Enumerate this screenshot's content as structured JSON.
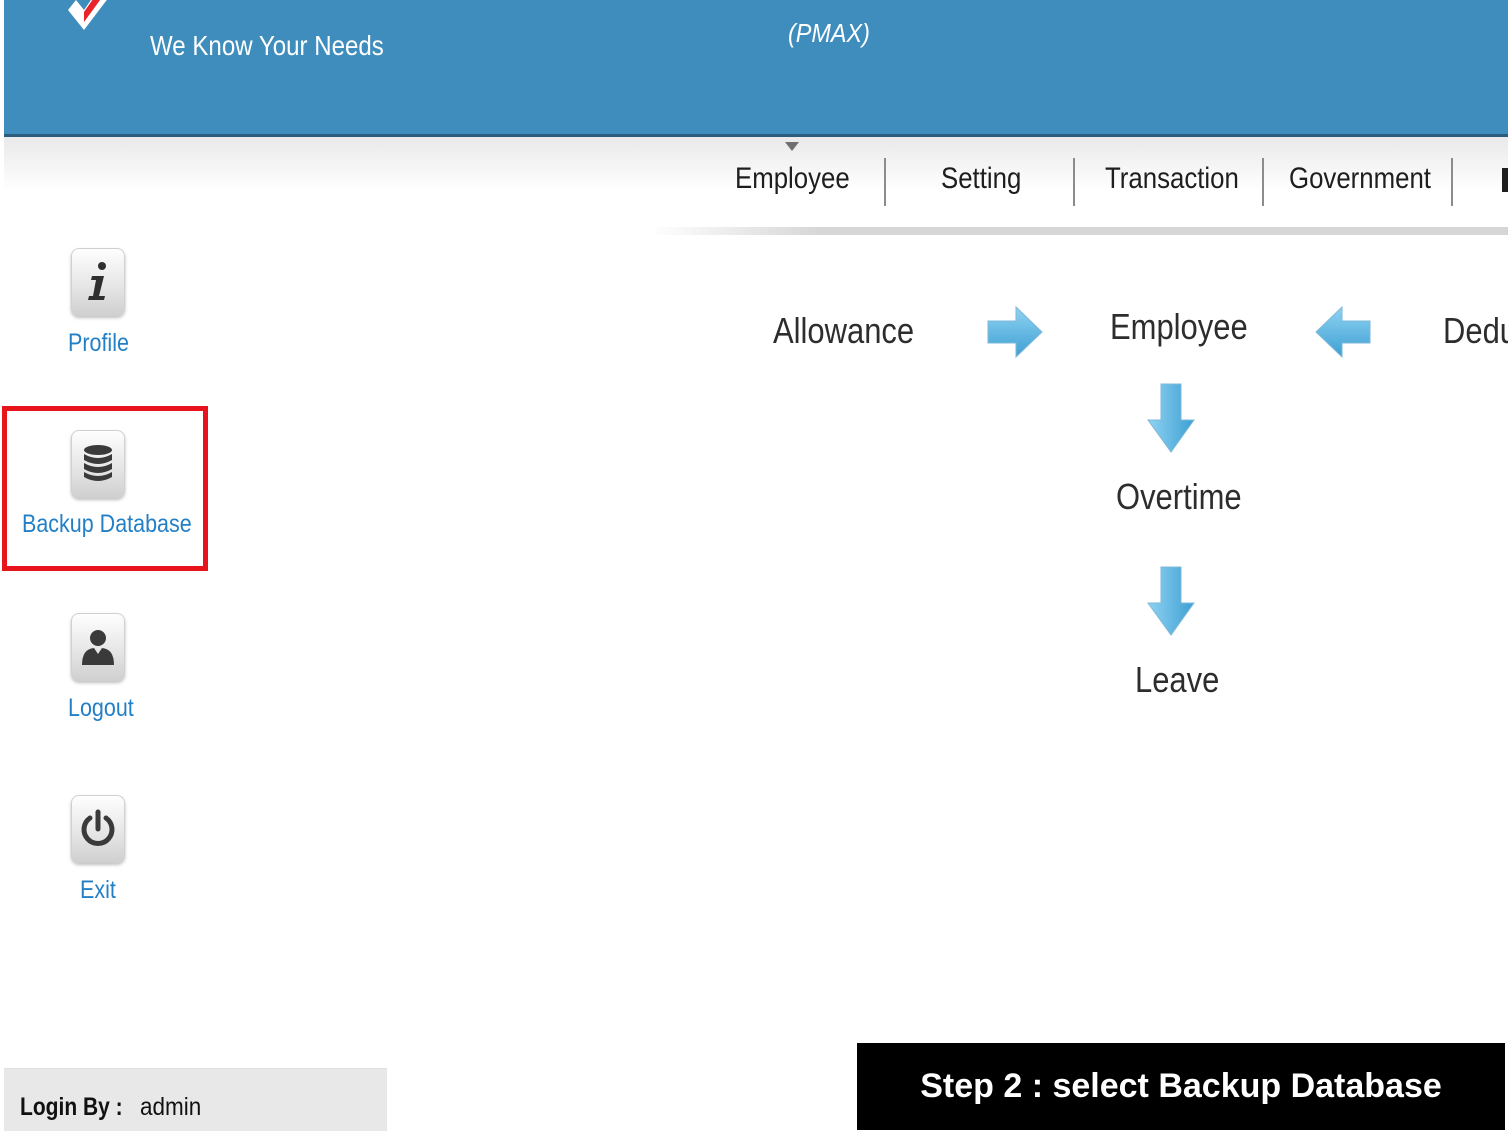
{
  "header": {
    "brand_partial": "",
    "tagline": "We Know Your Needs",
    "product_code": "(PMAX)"
  },
  "nav": {
    "items": [
      {
        "label": "Employee"
      },
      {
        "label": "Setting"
      },
      {
        "label": "Transaction"
      },
      {
        "label": "Government"
      }
    ]
  },
  "sidebar": {
    "items": [
      {
        "label": "Profile",
        "icon": "info-icon"
      },
      {
        "label": "Backup Database",
        "icon": "database-icon",
        "highlighted": true
      },
      {
        "label": "Logout",
        "icon": "user-icon"
      },
      {
        "label": "Exit",
        "icon": "power-icon"
      }
    ]
  },
  "workflow": {
    "allowance": "Allowance",
    "employee": "Employee",
    "deduction_partial": "Dedu",
    "overtime": "Overtime",
    "leave": "Leave"
  },
  "footer": {
    "login_label": "Login By :",
    "login_user": "admin"
  },
  "step_banner": "Step 2 : select Backup Database",
  "colors": {
    "header_bg": "#3f8dbd",
    "link_blue": "#2480c6",
    "highlight_red": "#e8141c",
    "arrow_blue": "#5bb6e3"
  }
}
